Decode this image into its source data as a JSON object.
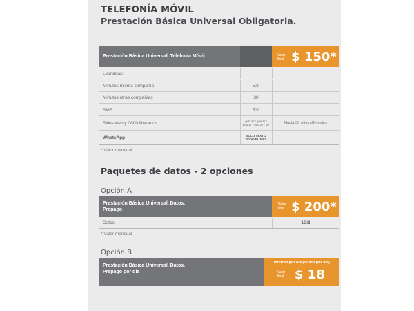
{
  "heading": {
    "title": "TELEFONÍA MÓVIL",
    "subtitle": "Prestación Básica Universal Obligatoria."
  },
  "plan": {
    "header_label": "Prestación Básica Universal. Telefonía Móvil",
    "value_label_1": "Valor",
    "value_label_2": "final",
    "price": "$ 150*",
    "rows": [
      {
        "label": "Llamadas:",
        "value": "",
        "extra": ""
      },
      {
        "label": "Minutos misma compañía",
        "value": "500",
        "extra": ""
      },
      {
        "label": "Minutos otras compañías",
        "value": "30",
        "extra": ""
      },
      {
        "label": "SMS",
        "value": "500",
        "extra": ""
      },
      {
        "label": "Sitios web y 0800 liberados",
        "value": "gob.ar / gov.ar / edu.ar / edu.ar / .ar",
        "extra": "Hasta 30 sitios diferentes"
      },
      {
        "label": "WhatsApp",
        "value": "SOLO TEXTO TODO EL MES",
        "extra": ""
      }
    ],
    "note": "* Valor mensual"
  },
  "data_section": {
    "title": "Paquetes de datos - 2 opciones"
  },
  "option_a": {
    "label": "Opción A",
    "header_line1": "Prestación Básica Universal. Datos.",
    "header_line2": "Prepago",
    "value_label_1": "Valor",
    "value_label_2": "final",
    "price": "$ 200*",
    "row_label": "Datos",
    "row_value": "1GB",
    "note": "* Valor mensual"
  },
  "option_b": {
    "label": "Opción B",
    "header_line1": "Prestación Básica Universal. Datos.",
    "header_line2": "Prepago por día",
    "internet_label": "Internet por día (50 mb por día)",
    "value_label_1": "Valor",
    "value_label_2": "final",
    "price": "$ 18"
  },
  "colors": {
    "header_gray": "#747579",
    "accent_orange": "#e8952e",
    "panel_bg": "#ebebec"
  }
}
